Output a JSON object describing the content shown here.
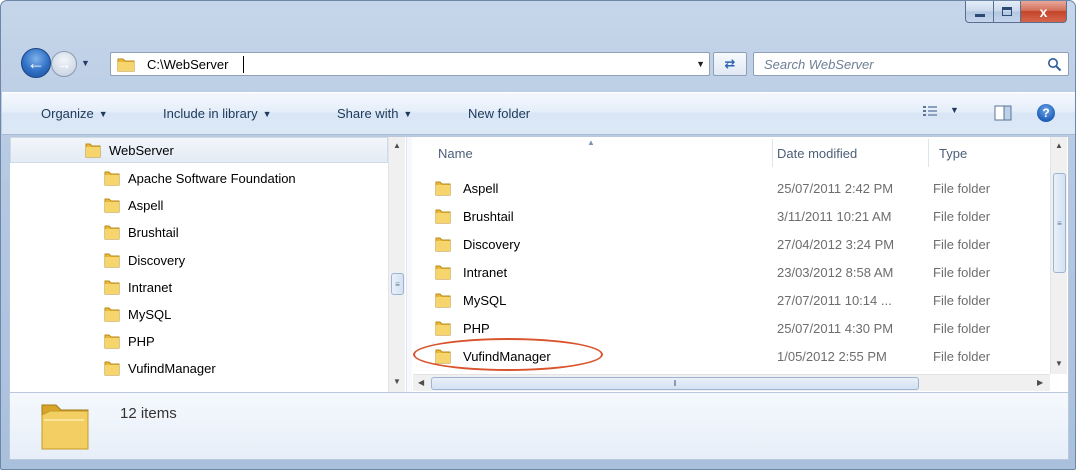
{
  "window": {
    "caption_buttons": {
      "minimize": "minimize-icon",
      "maximize": "maximize-icon",
      "close": "close-icon",
      "close_label": "x"
    }
  },
  "address_bar": {
    "path": "C:\\WebServer",
    "search_placeholder": "Search WebServer"
  },
  "toolbar": {
    "organize": "Organize",
    "include_in_library": "Include in library",
    "share_with": "Share with",
    "new_folder": "New folder"
  },
  "navigation_pane": {
    "root": "WebServer",
    "items": [
      {
        "label": "Apache Software Foundation"
      },
      {
        "label": "Aspell"
      },
      {
        "label": "Brushtail"
      },
      {
        "label": "Discovery"
      },
      {
        "label": "Intranet"
      },
      {
        "label": "MySQL"
      },
      {
        "label": "PHP"
      },
      {
        "label": "VufindManager"
      }
    ]
  },
  "file_list": {
    "columns": {
      "name": "Name",
      "date_modified": "Date modified",
      "type": "Type"
    },
    "sort_column": "name",
    "rows": [
      {
        "name": "Aspell",
        "date": "25/07/2011 2:42 PM",
        "type": "File folder"
      },
      {
        "name": "Brushtail",
        "date": "3/11/2011 10:21 AM",
        "type": "File folder"
      },
      {
        "name": "Discovery",
        "date": "27/04/2012 3:24 PM",
        "type": "File folder"
      },
      {
        "name": "Intranet",
        "date": "23/03/2012 8:58 AM",
        "type": "File folder"
      },
      {
        "name": "MySQL",
        "date": "27/07/2011 10:14 ...",
        "type": "File folder"
      },
      {
        "name": "PHP",
        "date": "25/07/2011 4:30 PM",
        "type": "File folder"
      },
      {
        "name": "VufindManager",
        "date": "1/05/2012 2:55 PM",
        "type": "File folder"
      }
    ],
    "highlighted_row": "VufindManager",
    "highlight_color": "#d9532c"
  },
  "details_pane": {
    "item_count": "12 items"
  },
  "colors": {
    "folder": "#f2c84b",
    "accent": "#2f6fc4",
    "toolbar_text": "#1e395b"
  }
}
